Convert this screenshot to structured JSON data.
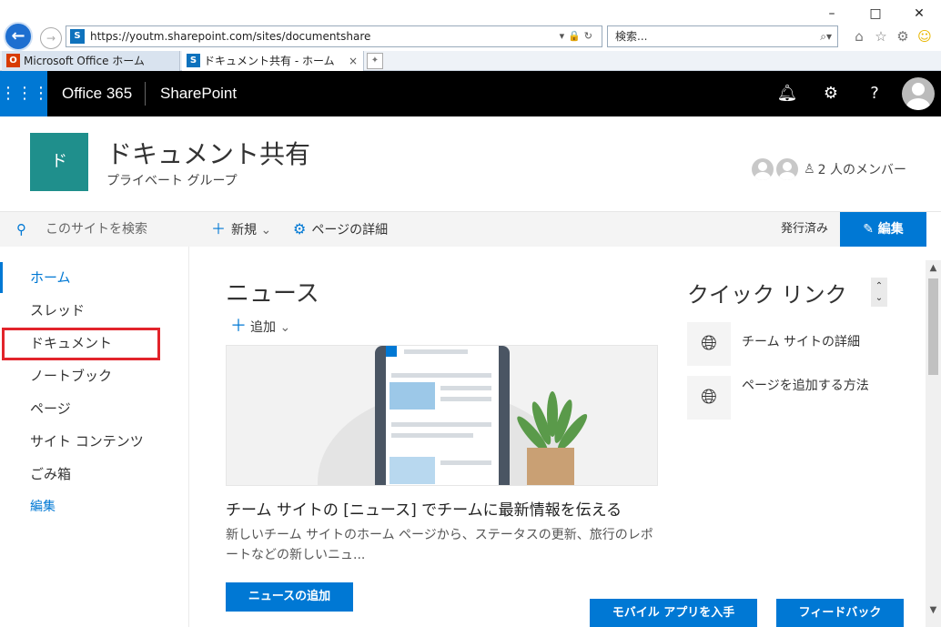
{
  "browser": {
    "window_controls": [
      "–",
      "□",
      "✕"
    ],
    "url": "https://youtm.sharepoint.com/sites/documentshare",
    "search_placeholder": "検索...",
    "tabs": [
      {
        "label": "Microsoft Office ホーム",
        "fav": "O"
      },
      {
        "label": "ドキュメント共有 - ホーム",
        "fav": "S"
      }
    ],
    "tab_close": "×"
  },
  "suitebar": {
    "app_name": "Office 365",
    "product": "SharePoint",
    "help": "?"
  },
  "site": {
    "logo_letter": "ド",
    "title": "ドキュメント共有",
    "subtitle": "プライベート グループ",
    "members": "2 人のメンバー"
  },
  "leftnav": {
    "search_placeholder": "このサイトを検索",
    "items": [
      "ホーム",
      "スレッド",
      "ドキュメント",
      "ノートブック",
      "ページ",
      "サイト コンテンツ",
      "ごみ箱"
    ],
    "edit": "編集"
  },
  "commandbar": {
    "new": "新規",
    "page_details": "ページの詳細",
    "status": "発行済み",
    "edit": "編集"
  },
  "news": {
    "title": "ニュース",
    "add": "追加",
    "headline": "チーム サイトの [ニュース] でチームに最新情報を伝える",
    "description": "新しいチーム サイトのホーム ページから、ステータスの更新、旅行のレポートなどの新しいニュ...",
    "add_button": "ニュースの追加"
  },
  "quicklinks": {
    "title": "クイック リンク",
    "items": [
      "チーム サイトの詳細",
      "ページを追加する方法"
    ]
  },
  "footer": {
    "mobile_app": "モバイル アプリを入手",
    "feedback": "フィードバック"
  },
  "colors": {
    "accent": "#0078d4",
    "site_logo": "#1f8f8c",
    "highlight_box": "#e2242b"
  }
}
